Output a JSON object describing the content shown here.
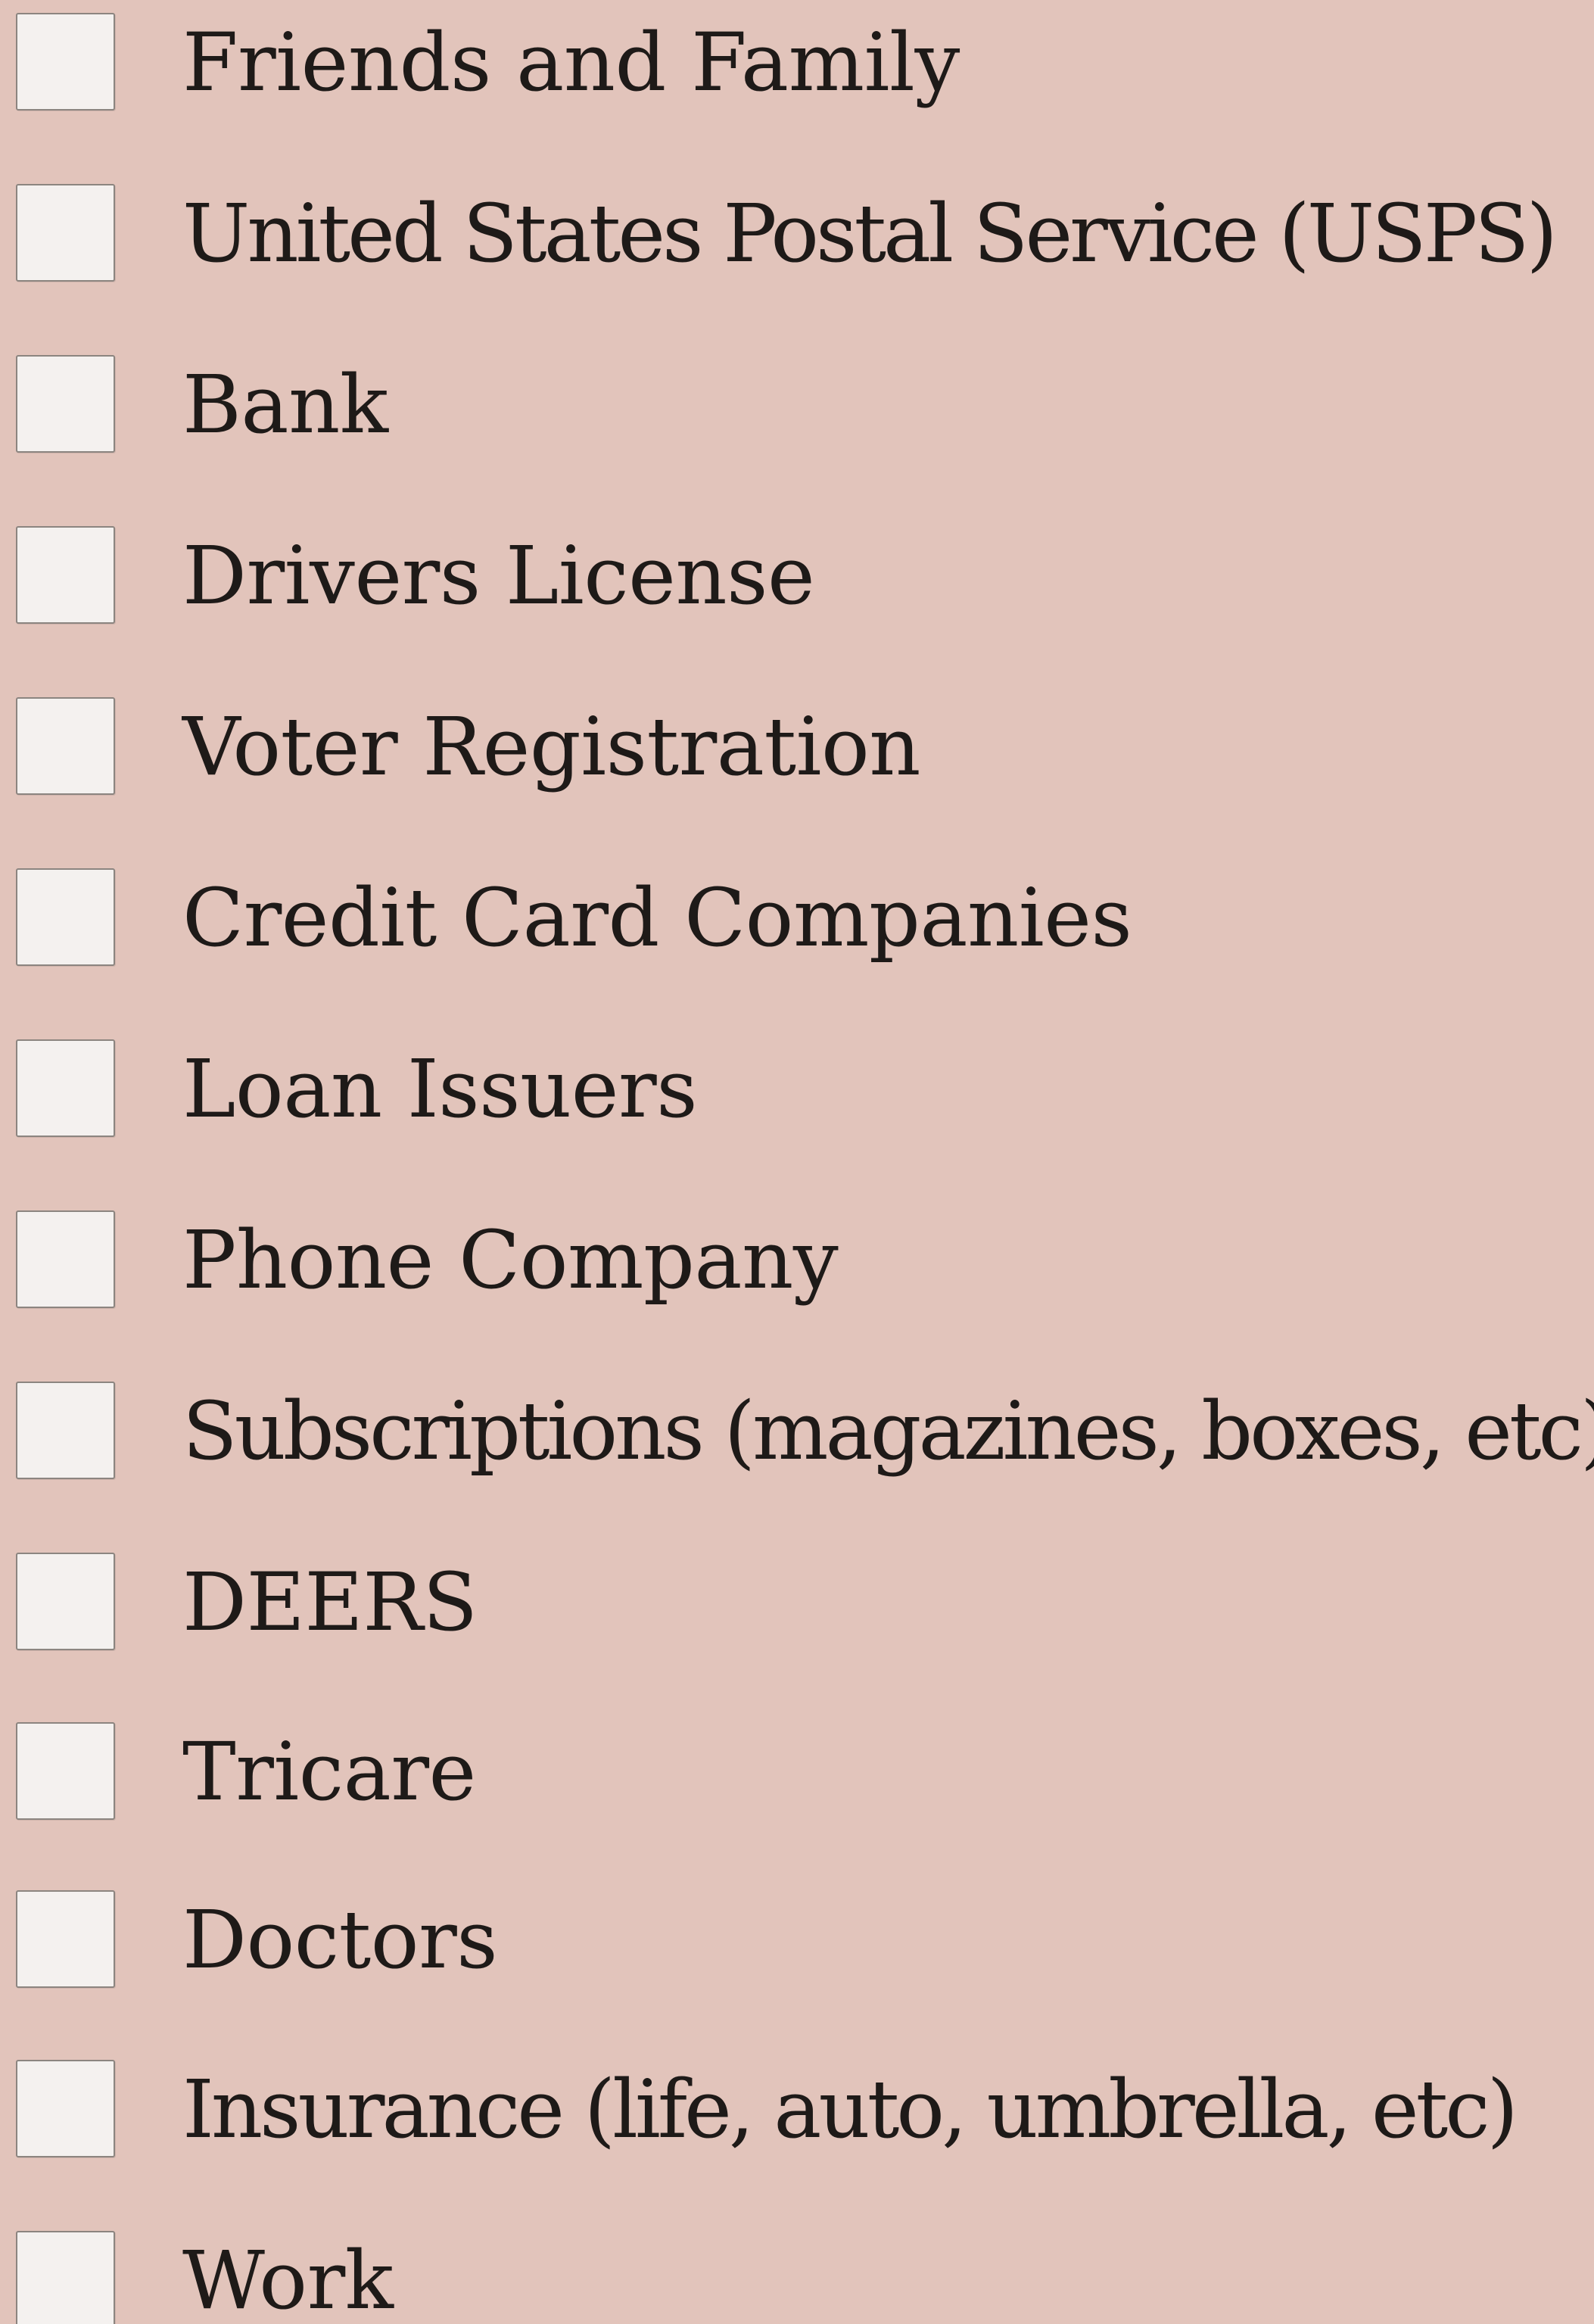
{
  "checklist": {
    "items": [
      {
        "label": "Friends and Family",
        "checked": false
      },
      {
        "label": "United States Postal Service (USPS)",
        "checked": false
      },
      {
        "label": "Bank",
        "checked": false
      },
      {
        "label": "Drivers License",
        "checked": false
      },
      {
        "label": "Voter Registration",
        "checked": false
      },
      {
        "label": "Credit Card Companies",
        "checked": false
      },
      {
        "label": "Loan Issuers",
        "checked": false
      },
      {
        "label": "Phone Company",
        "checked": false
      },
      {
        "label": "Subscriptions (magazines, boxes, etc)",
        "checked": false
      },
      {
        "label": "DEERS",
        "checked": false
      },
      {
        "label": "Tricare",
        "checked": false
      },
      {
        "label": "Doctors",
        "checked": false
      },
      {
        "label": "Insurance (life, auto, umbrella, etc)",
        "checked": false
      },
      {
        "label": "Work",
        "checked": false
      }
    ]
  },
  "colors": {
    "background": "#e2c4bb",
    "checkbox_fill": "#f4f1ef",
    "checkbox_border": "#8c8580",
    "text": "#1e1a18"
  }
}
